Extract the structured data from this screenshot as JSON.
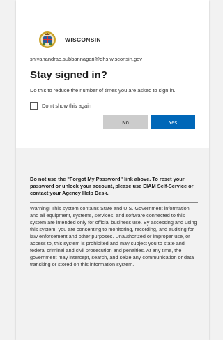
{
  "org": {
    "name": "WISCONSIN",
    "logo_icon": "wisconsin-seal-icon"
  },
  "dialog": {
    "email": "shivanandrao.subbannagari@dhs.wisconsin.gov",
    "title": "Stay signed in?",
    "description": "Do this to reduce the number of times you are asked to sign in.",
    "checkbox_label": "Don't show this again",
    "checkbox_checked": false,
    "no_label": "No",
    "yes_label": "Yes"
  },
  "footer": {
    "notice": "Do not use the \"Forgot My Password\" link above. To reset your password or unlock your account, please use EIAM Self-Service or contact your Agency Help Desk.",
    "warning": "Warning! This system contains State and U.S. Government information and all equipment, systems, services, and software connected to this system are intended only for official business use. By accessing and using this system, you are consenting to monitoring, recording, and auditing for law enforcement and other purposes. Unauthorized or improper use, or access to, this system is prohibited and may subject you to state and federal criminal and civil prosecution and penalties. At any time, the government may intercept, search, and seize any communication or data transiting or stored on this information system."
  },
  "colors": {
    "primary": "#0067b8",
    "secondary_button": "#cccccc",
    "page_background": "#f2f2f2"
  }
}
